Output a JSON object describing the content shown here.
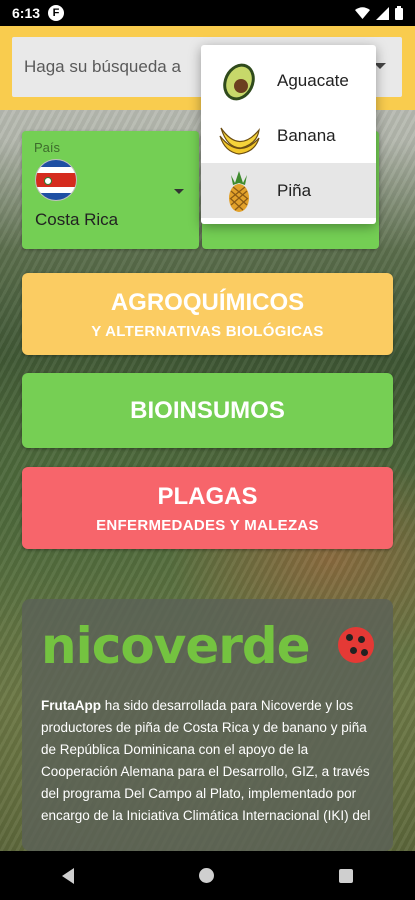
{
  "status_bar": {
    "time": "6:13",
    "notification_icon": "circle-f-icon",
    "icons": [
      "wifi-icon",
      "signal-icon",
      "battery-icon"
    ]
  },
  "search": {
    "placeholder": "Haga su búsqueda a"
  },
  "pais": {
    "label": "País",
    "value": "Costa Rica",
    "flag_icon": "costa-rica-flag-icon"
  },
  "cultivo_dropdown": {
    "options": [
      {
        "label": "Aguacate",
        "icon": "avocado-icon",
        "selected": false
      },
      {
        "label": "Banana",
        "icon": "banana-icon",
        "selected": false
      },
      {
        "label": "Piña",
        "icon": "pineapple-icon",
        "selected": true
      }
    ]
  },
  "buttons": {
    "agroquimicos": {
      "title": "AGROQUÍMICOS",
      "subtitle": "Y ALTERNATIVAS BIOLÓGICAS",
      "color": "#fbcc62"
    },
    "bioinsumos": {
      "title": "BIOINSUMOS",
      "color": "#76cf54"
    },
    "plagas": {
      "title": "PLAGAS",
      "subtitle": "ENFERMEDADES Y MALEZAS",
      "color": "#f7656b"
    }
  },
  "info": {
    "logo_text": "nicoverde",
    "brand": "FrutaApp",
    "text": " ha sido desarrollada para Nicoverde y los productores de piña de Costa Rica y de banano y piña de República Dominicana con el apoyo de la Cooperación Alemana para el Desarrollo, GIZ, a través del programa Del Campo al Plato, implementado por encargo de la Iniciativa Climática Internacional (IKI) del"
  },
  "colors": {
    "topbar": "#f9cc4e",
    "green_card": "#74cf54",
    "logo_green": "#74c340"
  }
}
